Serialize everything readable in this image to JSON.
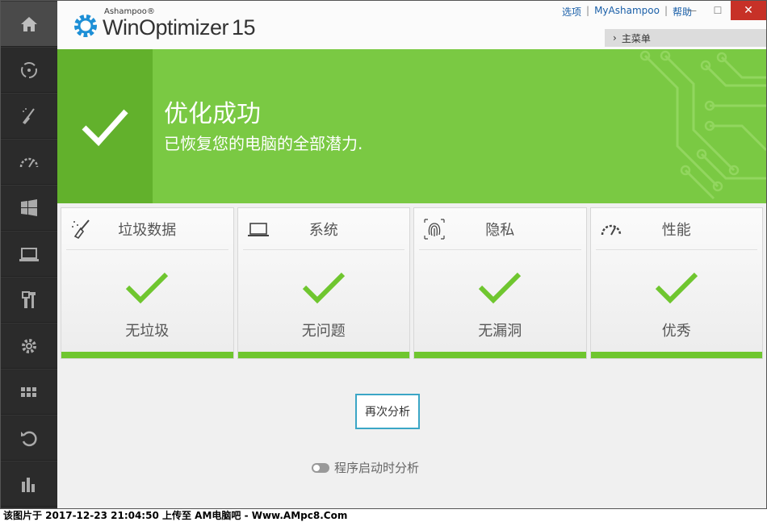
{
  "app": {
    "brand": "Ashampoo®",
    "product": "WinOptimizer",
    "version": "15"
  },
  "toplinks": {
    "options": "选项",
    "myashampoo": "MyAshampoo",
    "help": "帮助"
  },
  "window_controls": {
    "minimize": "—",
    "maximize": "☐",
    "close": "✕"
  },
  "mainmenu": {
    "chevron": "›",
    "label": "主菜单"
  },
  "sidebar": {
    "items": [
      {
        "icon": "home-icon",
        "active": true
      },
      {
        "icon": "maintenance-icon"
      },
      {
        "icon": "cleaner-icon"
      },
      {
        "icon": "speedometer-icon"
      },
      {
        "icon": "windows-icon"
      },
      {
        "icon": "laptop-icon"
      },
      {
        "icon": "tools-icon"
      },
      {
        "icon": "settings-gear-icon"
      },
      {
        "icon": "apps-grid-icon"
      },
      {
        "icon": "restore-icon"
      },
      {
        "icon": "stats-icon"
      }
    ]
  },
  "banner": {
    "title": "优化成功",
    "subtitle": "已恢复您的电脑的全部潜力.",
    "bg_color": "#7ac943"
  },
  "cards": [
    {
      "title": "垃圾数据",
      "status": "无垃圾",
      "icon": "broom-icon"
    },
    {
      "title": "系统",
      "status": "无问题",
      "icon": "laptop-icon"
    },
    {
      "title": "隐私",
      "status": "无漏洞",
      "icon": "fingerprint-icon"
    },
    {
      "title": "性能",
      "status": "优秀",
      "icon": "gauge-icon"
    }
  ],
  "actions": {
    "reanalyze": "再次分析",
    "startup_toggle": "程序启动时分析"
  },
  "footer": {
    "text": "该图片于  2017-12-23  21:04:50  上传至  AM电脑吧  -  Www.AMpc8.Com"
  },
  "colors": {
    "accent_green": "#7ac943",
    "check_green": "#6fc62f",
    "sidebar": "#2b2b2b",
    "close_red": "#c73127"
  }
}
